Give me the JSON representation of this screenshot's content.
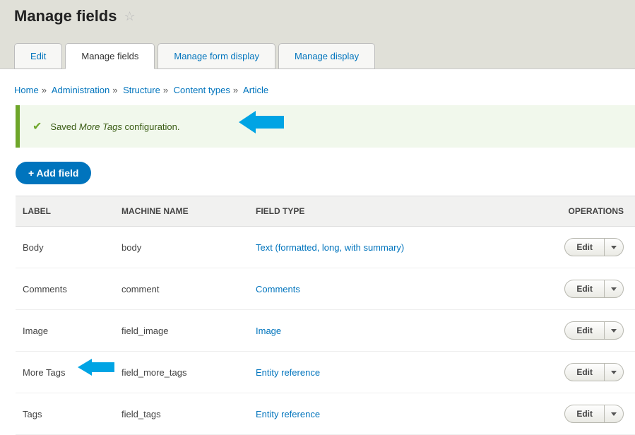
{
  "pageTitle": "Manage fields",
  "tabs": [
    {
      "label": "Edit",
      "active": false
    },
    {
      "label": "Manage fields",
      "active": true
    },
    {
      "label": "Manage form display",
      "active": false
    },
    {
      "label": "Manage display",
      "active": false
    }
  ],
  "breadcrumb": [
    "Home",
    "Administration",
    "Structure",
    "Content types",
    "Article"
  ],
  "message": {
    "prefix": "Saved ",
    "emphasis": "More Tags",
    "suffix": " configuration."
  },
  "addFieldLabel": "+ Add field",
  "columns": {
    "label": "Label",
    "machine": "Machine name",
    "type": "Field type",
    "ops": "Operations"
  },
  "rows": [
    {
      "label": "Body",
      "machine": "body",
      "type": "Text (formatted, long, with summary)",
      "edit": "Edit"
    },
    {
      "label": "Comments",
      "machine": "comment",
      "type": "Comments",
      "edit": "Edit"
    },
    {
      "label": "Image",
      "machine": "field_image",
      "type": "Image",
      "edit": "Edit"
    },
    {
      "label": "More Tags",
      "machine": "field_more_tags",
      "type": "Entity reference",
      "edit": "Edit"
    },
    {
      "label": "Tags",
      "machine": "field_tags",
      "type": "Entity reference",
      "edit": "Edit"
    }
  ]
}
